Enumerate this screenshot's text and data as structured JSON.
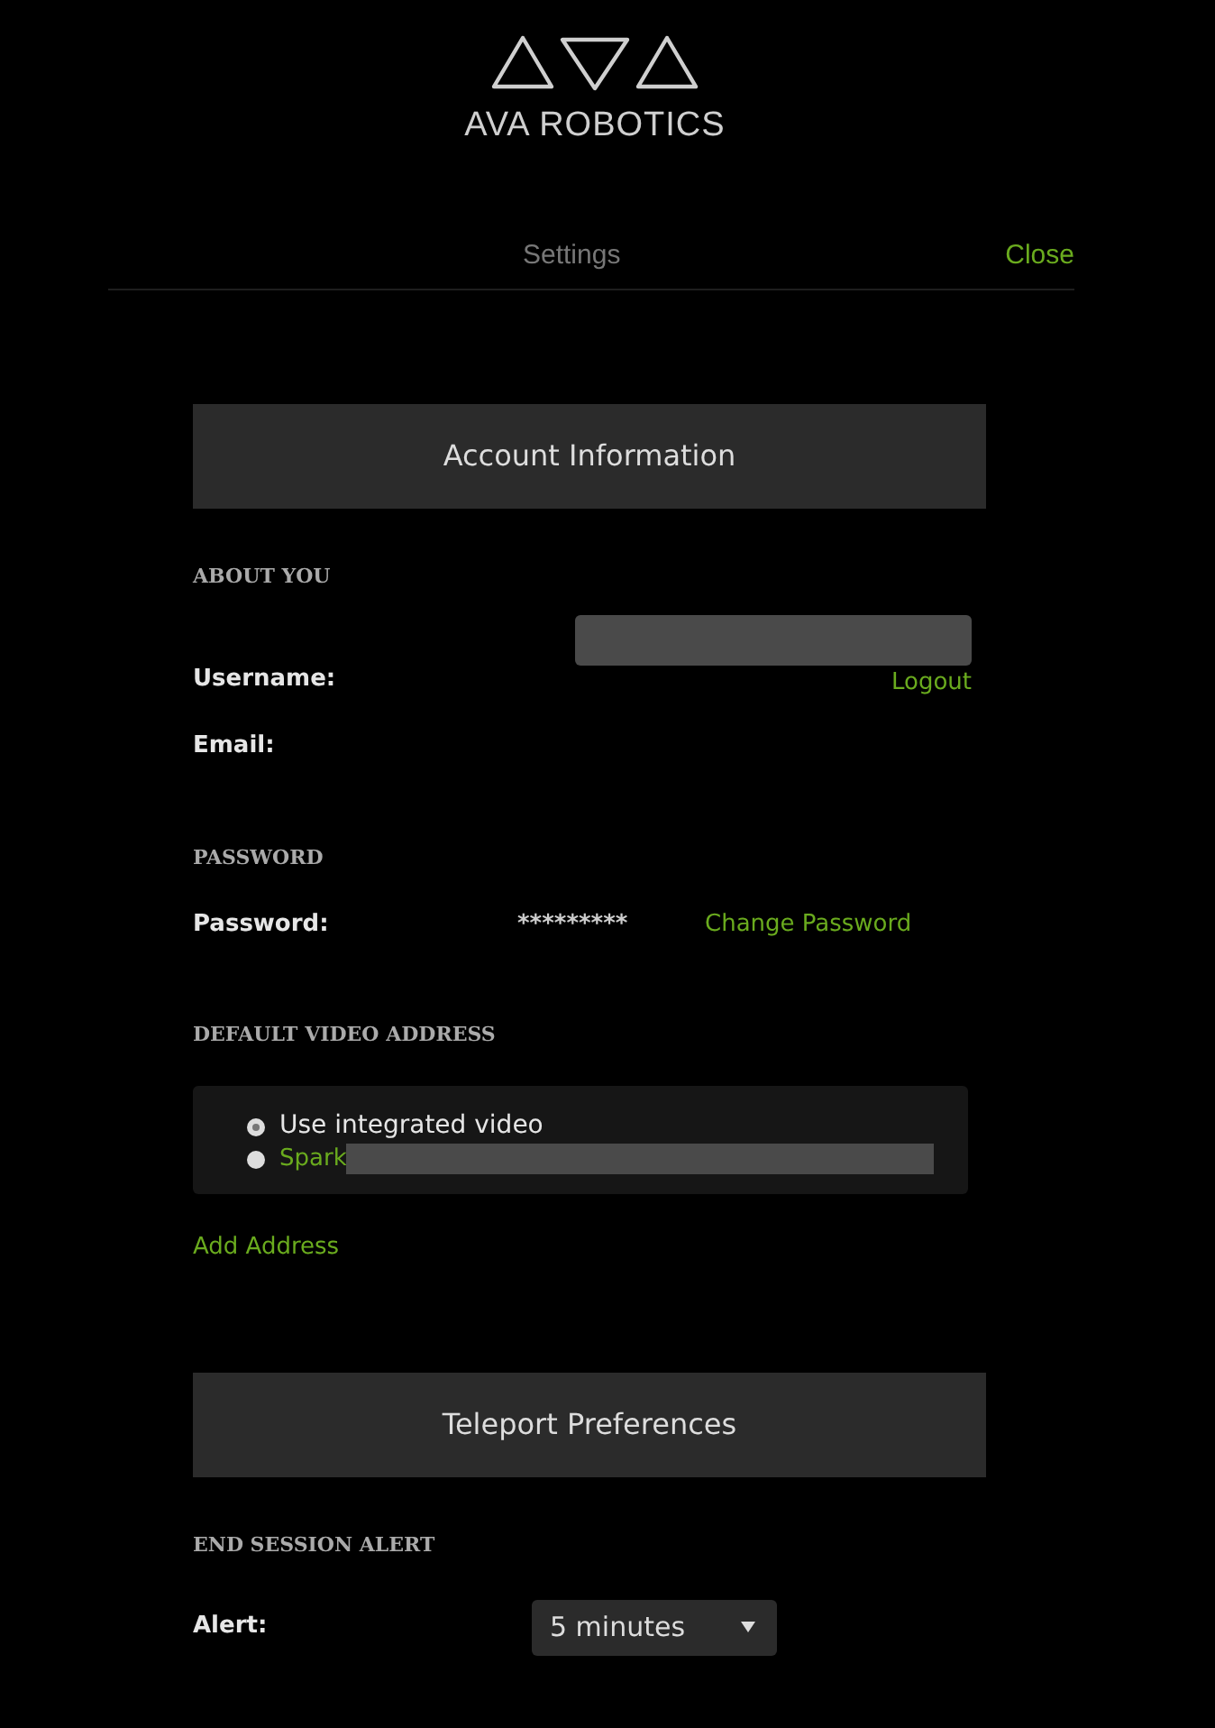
{
  "logo": {
    "text": "AVA ROBOTICS"
  },
  "header": {
    "title": "Settings",
    "close": "Close"
  },
  "account": {
    "title": "Account Information",
    "about_heading": "ABOUT YOU",
    "username_label": "Username:",
    "username_redacted": true,
    "logout": "Logout",
    "email_label": "Email:",
    "password_heading": "PASSWORD",
    "password_label": "Password:",
    "password_value": "*********",
    "change_password": "Change Password",
    "video_heading": "DEFAULT VIDEO ADDRESS",
    "video_options": [
      {
        "kind": "plain",
        "label": "Use integrated video",
        "selected": true
      },
      {
        "kind": "link",
        "label": "Spark",
        "redacted": true,
        "selected": false
      }
    ],
    "add_address": "Add Address"
  },
  "teleport": {
    "title": "Teleport Preferences",
    "alert_heading": "END SESSION ALERT",
    "alert_label": "Alert:",
    "alert_value": "5 minutes"
  }
}
